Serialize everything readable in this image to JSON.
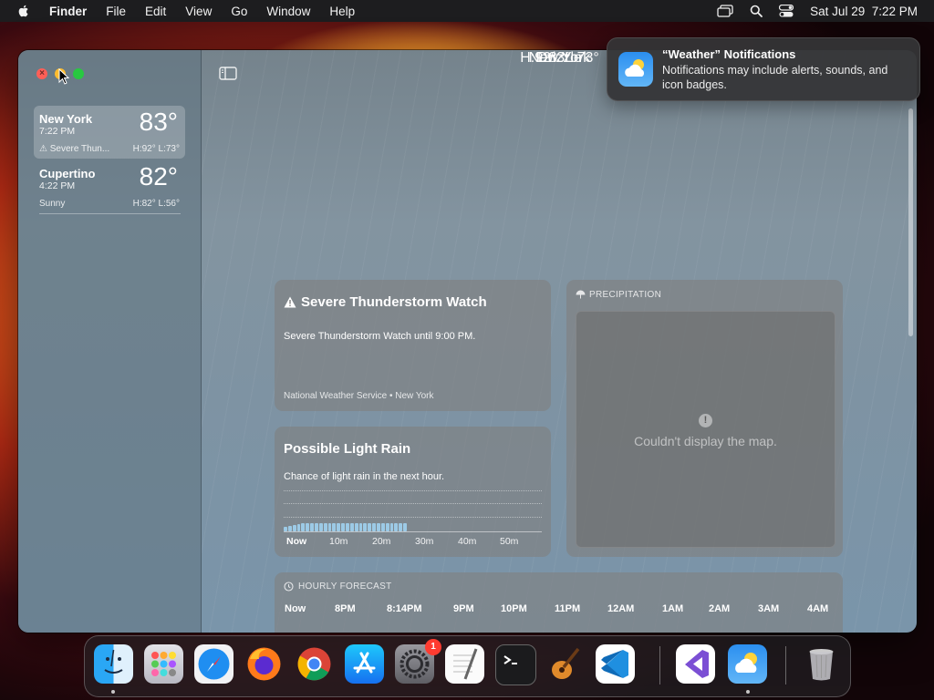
{
  "menubar": {
    "app_name": "Finder",
    "items": [
      "File",
      "Edit",
      "View",
      "Go",
      "Window",
      "Help"
    ],
    "clock": "Sat Jul 29  7:22 PM"
  },
  "sidebar": {
    "locations": [
      {
        "city": "New York",
        "time": "7:22 PM",
        "temp": "83°",
        "condition": "⚠ Severe Thun...",
        "high_low": "H:92°  L:73°"
      },
      {
        "city": "Cupertino",
        "time": "4:22 PM",
        "temp": "82°",
        "condition": "Sunny",
        "high_low": "H:82°  L:56°"
      }
    ]
  },
  "current": {
    "city": "New York",
    "temp": "83°",
    "condition": "Drizzle",
    "high_low": "H:92°  L:73°"
  },
  "alert": {
    "title": "Severe Thunderstorm Watch",
    "description": "Severe Thunderstorm Watch until 9:00 PM.",
    "source": "National Weather Service • New York"
  },
  "rain_forecast": {
    "title": "Possible Light Rain",
    "description": "Chance of light rain in the next hour.",
    "ticks": [
      "Now",
      "10m",
      "20m",
      "30m",
      "40m",
      "50m"
    ]
  },
  "precipitation": {
    "heading": "PRECIPITATION",
    "error": "Couldn't display the map."
  },
  "hourly": {
    "heading": "HOURLY FORECAST",
    "hours": [
      "Now",
      "8PM",
      "8:14PM",
      "9PM",
      "10PM",
      "11PM",
      "12AM",
      "1AM",
      "2AM",
      "3AM",
      "4AM"
    ]
  },
  "notification": {
    "title": "“Weather” Notifications",
    "body": "Notifications may include alerts, sounds, and icon badges."
  },
  "dock": {
    "apps": [
      "finder-icon",
      "launchpad-icon",
      "safari-icon",
      "firefox-icon",
      "chrome-icon",
      "app-store-icon",
      "system-settings-icon",
      "textedit-icon",
      "terminal-icon",
      "garageband-icon",
      "vscode-icon",
      "visual-studio-icon",
      "weather-icon",
      "trash-icon"
    ],
    "settings_badge": "1"
  }
}
